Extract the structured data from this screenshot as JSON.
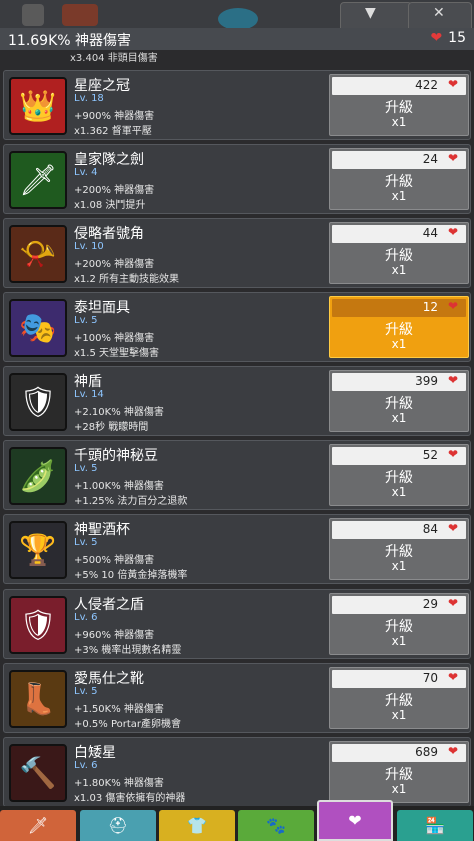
{
  "header": {
    "dps_text": "11.69K% 神器傷害",
    "heart_count": "15",
    "top_tab_icons": [
      "dropdown-arrow-icon",
      "close-icon"
    ],
    "partial_row_text": "x3.404 非頭目傷害"
  },
  "artifacts": [
    {
      "name": "星座之冠",
      "level": "Lv. 18",
      "effect1": "+900% 神器傷害",
      "effect2": "x1.362 督軍平壓",
      "cost": "422",
      "upgrade": "升級",
      "mult": "x1",
      "icon": "crown-icon",
      "glyph": "👑",
      "bg": "#b02020",
      "highlight": false
    },
    {
      "name": "皇家隊之劍",
      "level": "Lv. 4",
      "effect1": "+200% 神器傷害",
      "effect2": "x1.08 決鬥提升",
      "cost": "24",
      "upgrade": "升級",
      "mult": "x1",
      "icon": "sword-icon",
      "glyph": "🗡",
      "bg": "#1f5a1f",
      "highlight": false
    },
    {
      "name": "侵略者號角",
      "level": "Lv. 10",
      "effect1": "+200% 神器傷害",
      "effect2": "x1.2 所有主動技能效果",
      "cost": "44",
      "upgrade": "升級",
      "mult": "x1",
      "icon": "horn-icon",
      "glyph": "📯",
      "bg": "#5a2a18",
      "highlight": false
    },
    {
      "name": "泰坦面具",
      "level": "Lv. 5",
      "effect1": "+100% 神器傷害",
      "effect2": "x1.5 天堂聖擊傷害",
      "cost": "12",
      "upgrade": "升級",
      "mult": "x1",
      "icon": "mask-icon",
      "glyph": "🎭",
      "bg": "#3d2b6e",
      "highlight": true
    },
    {
      "name": "神盾",
      "level": "Lv. 14",
      "effect1": "+2.10K% 神器傷害",
      "effect2": "+28秒 戰矇時間",
      "cost": "399",
      "upgrade": "升級",
      "mult": "x1",
      "icon": "shield-icon",
      "glyph": "🛡",
      "bg": "#2a2a2a",
      "highlight": false
    },
    {
      "name": "千頭的神秘豆",
      "level": "Lv. 5",
      "effect1": "+1.00K% 神器傷害",
      "effect2": "+1.25% 法力百分之退款",
      "cost": "52",
      "upgrade": "升級",
      "mult": "x1",
      "icon": "bean-pod-icon",
      "glyph": "🫛",
      "bg": "#1e3a22",
      "highlight": false
    },
    {
      "name": "神聖酒杯",
      "level": "Lv. 5",
      "effect1": "+500% 神器傷害",
      "effect2": "+5% 10 倍黃金掉落機率",
      "cost": "84",
      "upgrade": "升級",
      "mult": "x1",
      "icon": "chalice-icon",
      "glyph": "🏆",
      "bg": "#2a2a30",
      "highlight": false
    },
    {
      "name": "人侵者之盾",
      "level": "Lv. 6",
      "effect1": "+960% 神器傷害",
      "effect2": "+3% 機率出現數名精靈",
      "cost": "29",
      "upgrade": "升級",
      "mult": "x1",
      "icon": "round-shield-icon",
      "glyph": "🛡",
      "bg": "#7a1e2c",
      "highlight": false
    },
    {
      "name": "愛馬仕之靴",
      "level": "Lv. 5",
      "effect1": "+1.50K% 神器傷害",
      "effect2": "+0.5% Portar產卵機會",
      "cost": "70",
      "upgrade": "升級",
      "mult": "x1",
      "icon": "winged-boot-icon",
      "glyph": "👢",
      "bg": "#5a3a12",
      "highlight": false
    },
    {
      "name": "白矮星",
      "level": "Lv. 6",
      "effect1": "+1.80K% 神器傷害",
      "effect2": "x1.03 傷害依擁有的神器",
      "cost": "689",
      "upgrade": "升級",
      "mult": "x1",
      "icon": "hammer-icon",
      "glyph": "🔨",
      "bg": "#3a1818",
      "highlight": false
    }
  ],
  "bottom_tabs": [
    {
      "icon": "sword-tab-icon",
      "glyph": "🗡",
      "color": "#d0643a",
      "selected": false
    },
    {
      "icon": "helmet-tab-icon",
      "glyph": "⛑",
      "color": "#4aa0b0",
      "selected": false
    },
    {
      "icon": "armor-tab-icon",
      "glyph": "👕",
      "color": "#d8b020",
      "selected": false
    },
    {
      "icon": "pet-tab-icon",
      "glyph": "🐾",
      "color": "#5aaa3a",
      "selected": false
    },
    {
      "icon": "artifact-heart-tab-icon",
      "glyph": "❤",
      "color": "#b050c0",
      "selected": true
    },
    {
      "icon": "shop-tab-icon",
      "glyph": "🏪",
      "color": "#2aa090",
      "selected": false
    }
  ]
}
